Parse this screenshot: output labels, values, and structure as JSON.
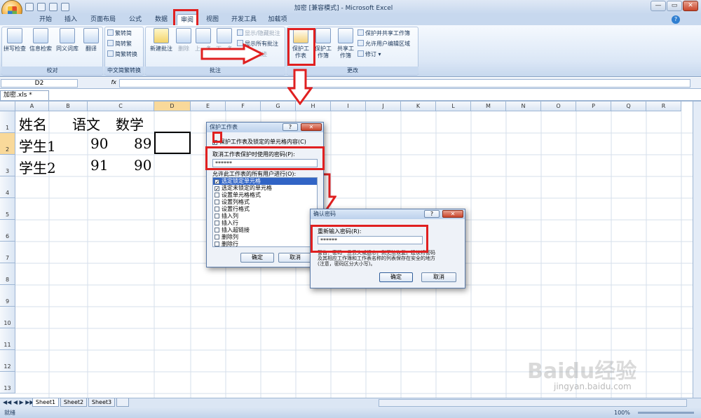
{
  "window": {
    "title": "加密 [兼容模式] - Microsoft Excel",
    "minimize": "—",
    "restore": "▭",
    "close": "✕"
  },
  "tabs": [
    "开始",
    "插入",
    "页面布局",
    "公式",
    "数据",
    "审阅",
    "视图",
    "开发工具",
    "加载项"
  ],
  "ribbon": {
    "proofing": {
      "title": "校对",
      "spell": "拼写检查",
      "research": "信息检索",
      "thesaurus": "同义词库",
      "translate": "翻译"
    },
    "chinese": {
      "title": "中文简繁转换",
      "t2s": "繁转简",
      "s2t": "简转繁",
      "convert": "简繁转换"
    },
    "comments": {
      "title": "批注",
      "new": "新建批注",
      "delete": "删除",
      "prev": "上一条",
      "next": "下一条",
      "show_hide": "显示/隐藏批注",
      "show_all": "显示所有批注",
      "show_ink": "显示墨迹"
    },
    "changes": {
      "title": "更改",
      "protect_sheet": "保护工作表",
      "protect_book": "保护工作簿",
      "share_book": "共享工作簿",
      "protect_share": "保护并共享工作簿",
      "allow_edit": "允许用户编辑区域",
      "track": "修订"
    }
  },
  "formula_bar": {
    "name_box": "D2",
    "fx": "fx",
    "value": ""
  },
  "document_tab": "加密.xls *",
  "columns": [
    "A",
    "B",
    "C",
    "D",
    "E",
    "F",
    "G",
    "H",
    "I",
    "J",
    "K",
    "L",
    "M",
    "N",
    "O",
    "P",
    "Q",
    "R"
  ],
  "rows": [
    "1",
    "2",
    "3",
    "4",
    "5",
    "6",
    "7",
    "8",
    "9",
    "10",
    "11",
    "12",
    "13"
  ],
  "cells": {
    "A1": "姓名",
    "B1": "语文",
    "C1": "数学",
    "A2": "学生1",
    "B2": "90",
    "C2": "89",
    "A3": "学生2",
    "B3": "91",
    "C3": "90"
  },
  "protect_dialog": {
    "title": "保护工作表",
    "help": "?",
    "close": "✕",
    "checkbox_label": "保护工作表及锁定的单元格内容(C)",
    "password_label": "取消工作表保护时使用的密码(P):",
    "password_value": "******",
    "allow_label": "允许此工作表的所有用户进行(O):",
    "permissions": [
      {
        "label": "选定锁定单元格",
        "checked": "✓"
      },
      {
        "label": "选定未锁定的单元格",
        "checked": "✓"
      },
      {
        "label": "设置单元格格式",
        "checked": ""
      },
      {
        "label": "设置列格式",
        "checked": ""
      },
      {
        "label": "设置行格式",
        "checked": ""
      },
      {
        "label": "插入列",
        "checked": ""
      },
      {
        "label": "插入行",
        "checked": ""
      },
      {
        "label": "插入超链接",
        "checked": ""
      },
      {
        "label": "删除列",
        "checked": ""
      },
      {
        "label": "删除行",
        "checked": ""
      }
    ],
    "ok": "确定",
    "cancel": "取消"
  },
  "confirm_dialog": {
    "title": "确认密码",
    "help": "?",
    "close": "✕",
    "label": "重新输入密码(R):",
    "value": "******",
    "warning_1": "警告：密码一旦丢失或遗忘，则无法恢复。建议将密码",
    "warning_2": "及其相应工作簿和工作表名称的列表保存在安全的地方",
    "warning_3": "(注意，密码区分大小写)。",
    "ok": "确定",
    "cancel": "取消"
  },
  "sheets": [
    "Sheet1",
    "Sheet2",
    "Sheet3"
  ],
  "status": {
    "ready": "就绪",
    "zoom": "100%"
  },
  "watermark": {
    "logo": "Baidu经验",
    "url": "jingyan.baidu.com"
  },
  "colors": {
    "annotation_red": "#e02020",
    "ribbon_blue": "#c7d8ee",
    "selected_header": "#f9d99a"
  }
}
